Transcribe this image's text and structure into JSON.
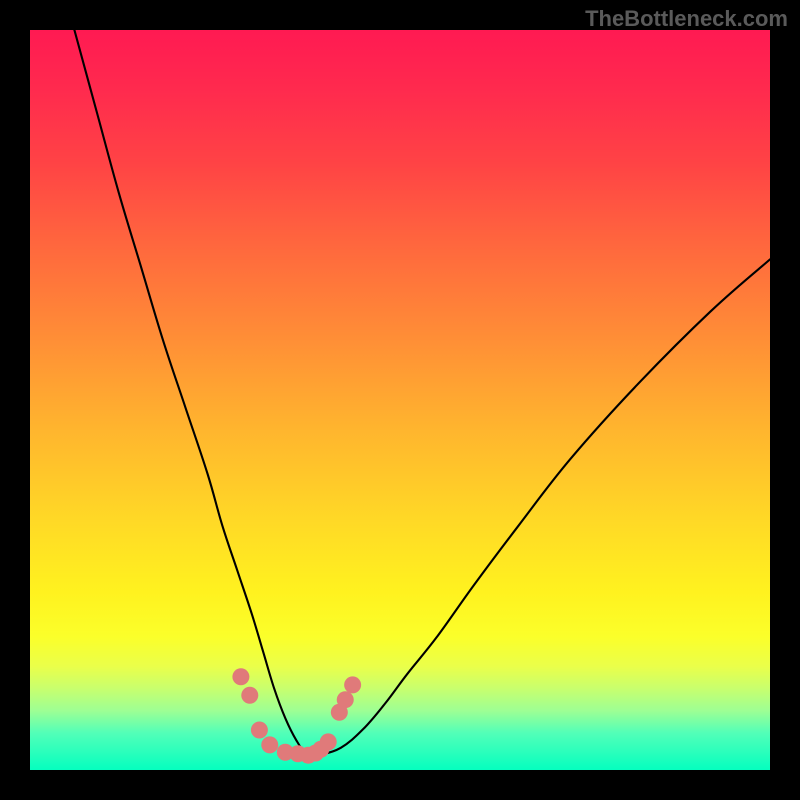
{
  "watermark": "TheBottleneck.com",
  "chart_data": {
    "type": "line",
    "title": "",
    "xlabel": "",
    "ylabel": "",
    "xlim": [
      0,
      100
    ],
    "ylim": [
      0,
      100
    ],
    "series": [
      {
        "name": "bottleneck-curve",
        "x": [
          6,
          9,
          12,
          15,
          18,
          21,
          24,
          26,
          28,
          30,
          31.5,
          33,
          34.5,
          36,
          37.5,
          39,
          42,
          45,
          48,
          51,
          55,
          60,
          66,
          73,
          82,
          92,
          100
        ],
        "y": [
          100,
          89,
          78,
          68,
          58,
          49,
          40,
          33,
          27,
          21,
          16,
          11,
          7,
          4,
          2,
          2,
          3,
          5.5,
          9,
          13,
          18,
          25,
          33,
          42,
          52,
          62,
          69
        ]
      }
    ],
    "markers": {
      "name": "highlight-dots",
      "color": "#e07a7a",
      "points_xy": [
        [
          28.5,
          12.6
        ],
        [
          29.7,
          10.1
        ],
        [
          31.0,
          5.4
        ],
        [
          32.4,
          3.4
        ],
        [
          34.5,
          2.4
        ],
        [
          36.2,
          2.2
        ],
        [
          37.6,
          2.0
        ],
        [
          38.6,
          2.3
        ],
        [
          39.3,
          2.8
        ],
        [
          40.3,
          3.8
        ],
        [
          41.8,
          7.8
        ],
        [
          42.6,
          9.5
        ],
        [
          43.6,
          11.5
        ]
      ]
    },
    "background_gradient": {
      "top": "#ff1a52",
      "middle": "#ffd826",
      "bottom": "#05ffbf"
    }
  }
}
